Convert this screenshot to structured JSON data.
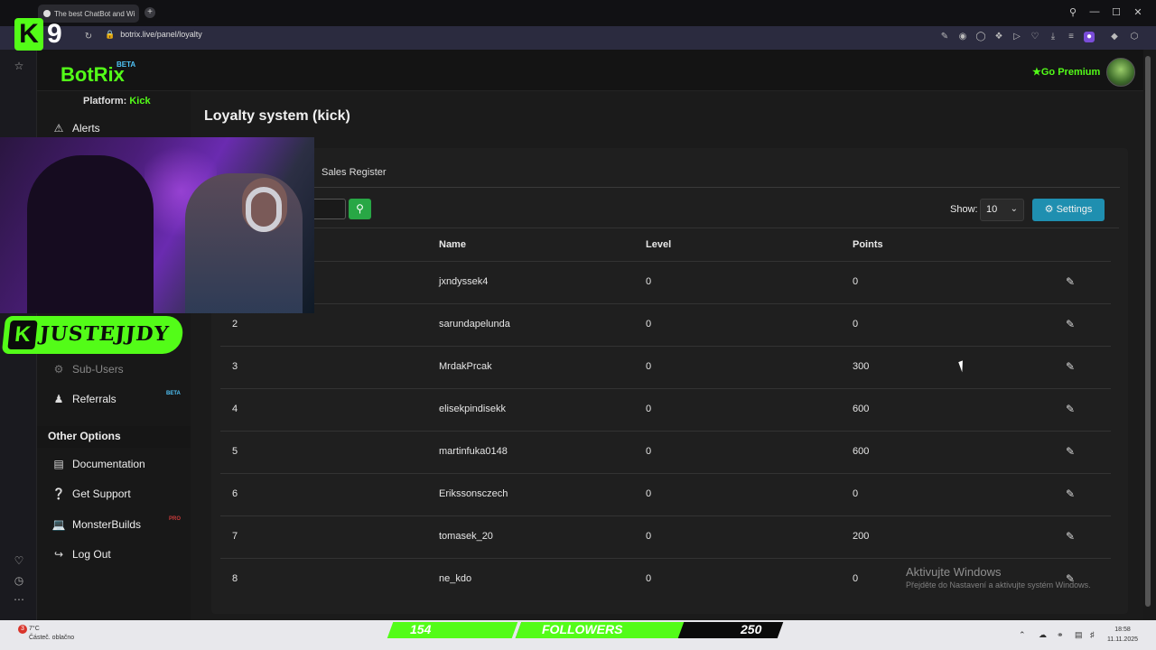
{
  "browser": {
    "tab_title": "The best ChatBot and Wi",
    "new_tab_symbol": "+",
    "url": "botrix.live/panel/loyalty",
    "window_controls": [
      "search",
      "minimize",
      "maximize",
      "close"
    ]
  },
  "overlay": {
    "logo_letter": "K",
    "logo_number": "9",
    "nameplate_letter": "K",
    "nameplate_text": "JUSTEJJDY"
  },
  "header": {
    "brand": "BotRix",
    "beta": "BETA",
    "go_premium": "Go Premium"
  },
  "sidebar": {
    "platform_label": "Platform:",
    "platform_value": "Kick",
    "items": [
      {
        "label": "Alerts",
        "icon": "warning-icon"
      },
      {
        "label": "Sub-Users",
        "icon": "gears-icon"
      },
      {
        "label": "Referrals",
        "icon": "users-icon",
        "badge": "BETA"
      }
    ],
    "other_title": "Other Options",
    "other_items": [
      {
        "label": "Documentation",
        "icon": "scroll-icon"
      },
      {
        "label": "Get Support",
        "icon": "question-icon"
      },
      {
        "label": "MonsterBuilds",
        "icon": "laptop-icon",
        "badge": "PRO"
      },
      {
        "label": "Log Out",
        "icon": "logout-icon"
      }
    ]
  },
  "main": {
    "title": "Loyalty system (kick)",
    "tab_sales": "Sales Register",
    "show_label": "Show:",
    "show_value": "10",
    "settings_label": "Settings",
    "columns": [
      "Name",
      "Level",
      "Points"
    ],
    "rows": [
      {
        "rank": "",
        "name": "jxndyssek4",
        "level": "0",
        "points": "0"
      },
      {
        "rank": "2",
        "name": "sarundapelunda",
        "level": "0",
        "points": "0"
      },
      {
        "rank": "3",
        "name": "MrdakPrcak",
        "level": "0",
        "points": "300"
      },
      {
        "rank": "4",
        "name": "elisekpindisekk",
        "level": "0",
        "points": "600"
      },
      {
        "rank": "5",
        "name": "martinfuka0148",
        "level": "0",
        "points": "600"
      },
      {
        "rank": "6",
        "name": "Erikssonsczech",
        "level": "0",
        "points": "0"
      },
      {
        "rank": "7",
        "name": "tomasek_20",
        "level": "0",
        "points": "200"
      },
      {
        "rank": "8",
        "name": "ne_kdo",
        "level": "0",
        "points": "0"
      }
    ]
  },
  "watermark": {
    "line1": "Aktivujte Windows",
    "line2": "Přejděte do Nastavení a aktivujte systém Windows."
  },
  "taskbar": {
    "weather_temp": "7°C",
    "weather_desc": "Částeč. oblačno",
    "weather_badge": "3",
    "followers_current": "154",
    "followers_label": "FOLLOWERS",
    "followers_goal": "250",
    "followers_progress": 0.62,
    "time": "18:58",
    "date": "11.11.2025"
  },
  "colors": {
    "accent_green": "#53fc18",
    "settings_blue": "#1f8fb0",
    "search_green": "#28a745"
  }
}
